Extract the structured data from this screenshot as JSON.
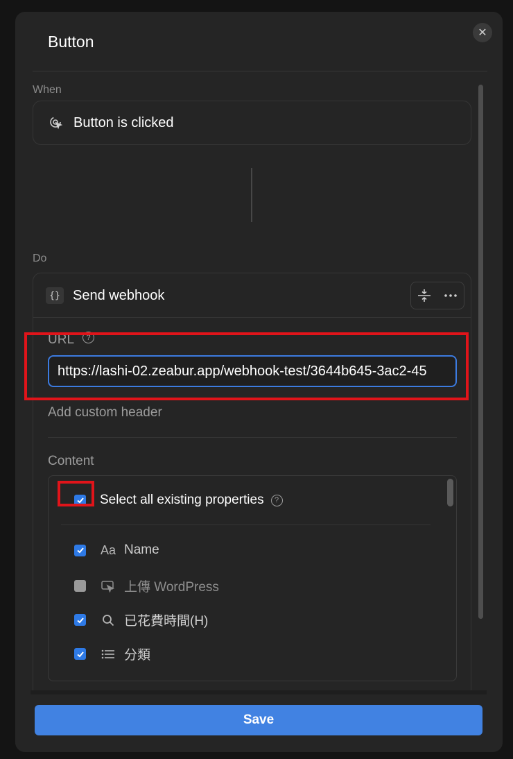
{
  "dialog": {
    "title": "Button",
    "close_icon": "close-icon"
  },
  "when": {
    "label": "When",
    "trigger_label": "Button is clicked",
    "trigger_icon": "click-cursor-icon"
  },
  "do": {
    "label": "Do",
    "action_title": "Send webhook",
    "action_icon": "code-braces-icon",
    "action_icon_glyph": "{}",
    "tools": [
      "collapse-icon",
      "more-icon"
    ]
  },
  "webhook": {
    "url_label": "URL",
    "url_value": "https://lashi-02.zeabur.app/webhook-test/3644b645-3ac2-45",
    "add_header_label": "Add custom header",
    "content_label": "Content"
  },
  "properties": {
    "select_all_label": "Select all existing properties",
    "select_all_checked": true,
    "items": [
      {
        "icon_text": "Aa",
        "icon_name": "text-property-icon",
        "label": "Name",
        "checked": true
      },
      {
        "icon_text": "⬚",
        "icon_name": "button-property-icon",
        "label": "上傳 WordPress",
        "checked": false
      },
      {
        "icon_text": "⌕",
        "icon_name": "search-property-icon",
        "label": "已花費時間(H)",
        "checked": true
      },
      {
        "icon_text": "☰",
        "icon_name": "list-property-icon",
        "label": "分類",
        "checked": true
      }
    ]
  },
  "footer": {
    "save_label": "Save"
  },
  "colors": {
    "accent": "#4182e2",
    "highlight": "#e0141a",
    "background": "#252525"
  }
}
